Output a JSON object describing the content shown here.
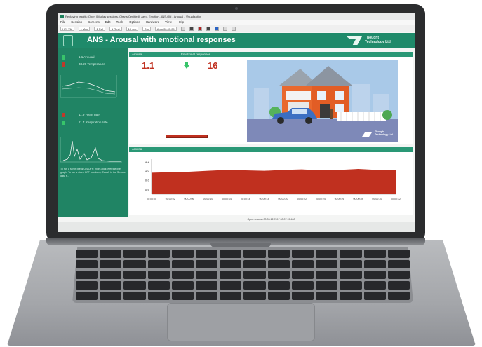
{
  "window": {
    "title": "Replaying results: Open (Display sessions, Charts Certified), Aero, Emotion, ANS-Old - Arousal - Visualization"
  },
  "menu": [
    "File",
    "Session",
    "Screens",
    "Edit",
    "Tools",
    "Options",
    "Hardware",
    "View",
    "Help"
  ],
  "toolbar": {
    "fields": [
      "HR: Vlk",
      "1 Max",
      "1 Ref",
      "1 Rest",
      "10 sec",
      "0 s",
      "Auto 00:03:09"
    ]
  },
  "header": {
    "title": "ANS - Arousal with emotional responses",
    "logo_line1": "Thought",
    "logo_line2": "Technology Ltd."
  },
  "sidebar": {
    "rows": [
      {
        "label": "1.1 Arousal",
        "color": "#38c46a"
      },
      {
        "label": "33.26 Temperature",
        "color": "#c0392b"
      },
      {
        "label": "11.9 Heart rate",
        "color": "#c0392b"
      },
      {
        "label": "11.7 Respiration rate",
        "color": "#38c46a"
      }
    ],
    "note": "To run a script press ON/OFF; Right-click over the live graph. To run a video OFF (random). Equal* in the Session data s..."
  },
  "panels": {
    "top": {
      "col1": "Arousal",
      "col2": "Emotional responses",
      "value1": "1.1",
      "value2": "16"
    },
    "arousal": {
      "title": "Arousal"
    }
  },
  "scene": {
    "logo_line1": "Thought",
    "logo_line2": "Technology Ltd."
  },
  "chart_data": {
    "type": "area",
    "title": "",
    "y_ticks": [
      "1.2",
      "1.0",
      "0.8",
      "0.6"
    ],
    "ylim": [
      0.5,
      1.25
    ],
    "x": [
      "00:00:00",
      "00:00:02",
      "00:00:06",
      "00:00:10",
      "00:00:14",
      "00:00:16",
      "00:00:18",
      "00:00:20",
      "00:00:22",
      "00:00:24",
      "00:00:26",
      "00:00:28",
      "00:00:30",
      "00:00:32"
    ],
    "values": [
      0.96,
      0.97,
      0.98,
      1.0,
      1.02,
      1.01,
      1.0,
      1.02,
      1.03,
      1.01,
      1.02,
      1.04,
      1.02,
      1.01
    ],
    "color": "#c0301f"
  },
  "status": {
    "text": "Open session 00:03:12.709 / 00:07:15.400"
  }
}
